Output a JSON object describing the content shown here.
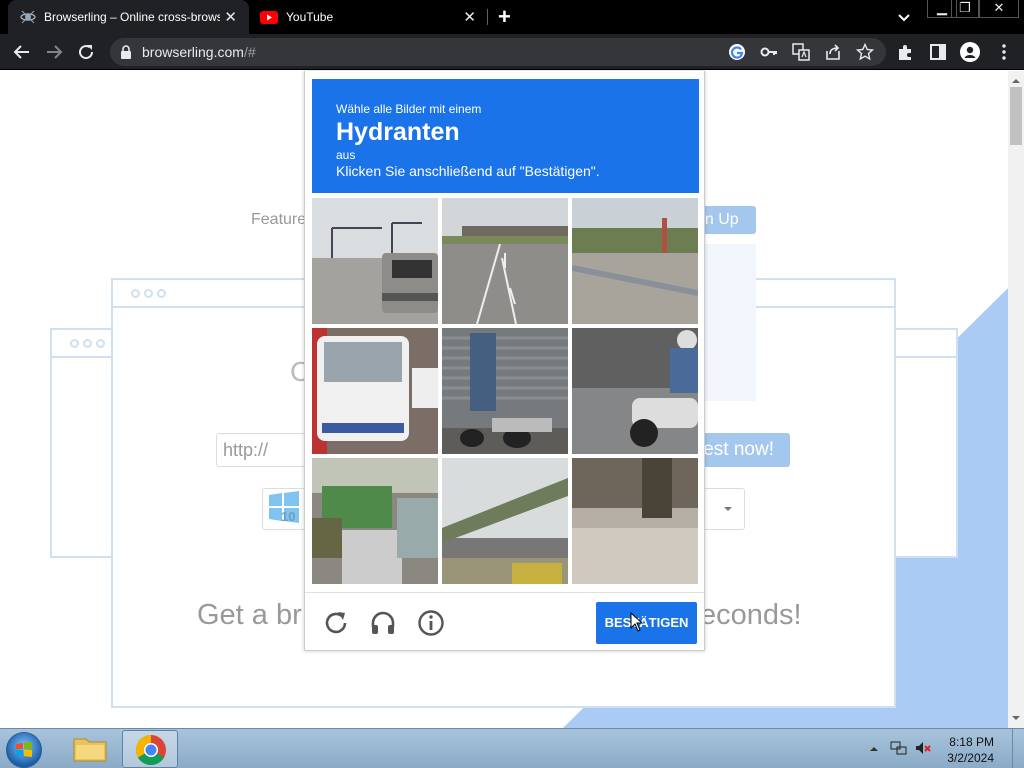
{
  "browser": {
    "tabs": [
      {
        "title": "Browserling – Online cross-browser testing",
        "active": true
      },
      {
        "title": "YouTube",
        "active": false
      }
    ],
    "address": {
      "host": "browserling.com",
      "path": "/#"
    }
  },
  "page": {
    "features_label": "Feature",
    "signup_label": "gn Up",
    "url_placeholder": "http://",
    "test_now_label": "est now!",
    "os_badge": "10",
    "tagline_left": "Get a br",
    "tagline_right": "econds!"
  },
  "captcha": {
    "instruction_line1": "Wähle alle Bilder mit einem",
    "keyword": "Hydranten",
    "instruction_line2": "aus",
    "instruction_line3": "Klicken Sie anschließend auf \"Bestätigen\".",
    "verify_label": "BESTÄTIGEN",
    "tiles": [
      "street-intersection-pickup",
      "highway-overpass",
      "roadside-guardrail",
      "white-van-traffic",
      "parked-scooters-shutter",
      "motorcycle-rider",
      "green-truck-traffic",
      "elevated-road-traffic",
      "blurry-sidewalk"
    ]
  },
  "taskbar": {
    "time": "8:18 PM",
    "date": "3/2/2024"
  },
  "colors": {
    "accent": "#1a73e8",
    "chrome_dark": "#202124",
    "page_blue": "#a9cbf4"
  }
}
